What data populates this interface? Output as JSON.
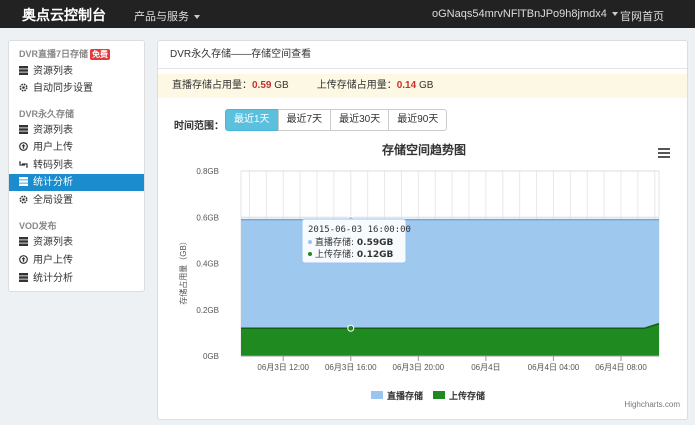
{
  "topbar": {
    "brand": "奥点云控制台",
    "menu": "产品与服务",
    "account": "oGNaqs54mrvNFlTBnJPo9h8jmdx4",
    "home": "官网首页"
  },
  "sidebar": {
    "group1": {
      "label": "DVR直播7日存储",
      "badge": "免费"
    },
    "group1_items": [
      "资源列表",
      "自动同步设置"
    ],
    "group2": {
      "label": "DVR永久存储"
    },
    "group2_items": [
      "资源列表",
      "用户上传",
      "转码列表",
      "统计分析",
      "全局设置"
    ],
    "group3": {
      "label": "VOD发布"
    },
    "group3_items": [
      "资源列表",
      "用户上传",
      "统计分析"
    ]
  },
  "panel": {
    "title": "DVR永久存储——存储空间查看",
    "usage": {
      "live_label": "直播存储占用量：",
      "live_value": "0.59",
      "live_unit": " GB",
      "upload_label": "上传存储占用量：",
      "upload_value": "0.14",
      "upload_unit": " GB"
    },
    "range_label": "时间范围：",
    "ranges": [
      "最近1天",
      "最近7天",
      "最近30天",
      "最近90天"
    ],
    "active_range": 0
  },
  "colors": {
    "live": "#9ac5ee",
    "upload": "#1f8a1f",
    "accent": "#1b8ccd",
    "active_btn": "#5bc0de"
  },
  "chart_data": {
    "type": "area",
    "title": "存储空间趋势图",
    "ylabel": "存储占用量（GB）",
    "ylim": [
      0,
      0.8
    ],
    "yticks": [
      "0GB",
      "0.2GB",
      "0.4GB",
      "0.6GB",
      "0.8GB"
    ],
    "xticks": [
      "06月3日 12:00",
      "06月3日 16:00",
      "06月3日 20:00",
      "06月4日",
      "06月4日 04:00",
      "06月4日 08:00"
    ],
    "xtick_hours": [
      12,
      16,
      20,
      24,
      28,
      32
    ],
    "x_hours": [
      9.5,
      34.25
    ],
    "stacking": "overlap",
    "series": [
      {
        "name": "直播存储",
        "points": [
          [
            9.5,
            0.59
          ],
          [
            34.25,
            0.59
          ]
        ]
      },
      {
        "name": "上传存储",
        "points": [
          [
            9.5,
            0.12
          ],
          [
            33.4,
            0.12
          ],
          [
            34.25,
            0.14
          ]
        ]
      }
    ],
    "tooltip": {
      "title": "2015-06-03 16:00:00",
      "lines": [
        {
          "label": "直播存储: ",
          "value": "0.59GB"
        },
        {
          "label": "上传存储: ",
          "value": "0.12GB"
        }
      ],
      "hour": 16
    },
    "legend": "bottom-center",
    "credit": "Highcharts.com",
    "grid": true
  }
}
